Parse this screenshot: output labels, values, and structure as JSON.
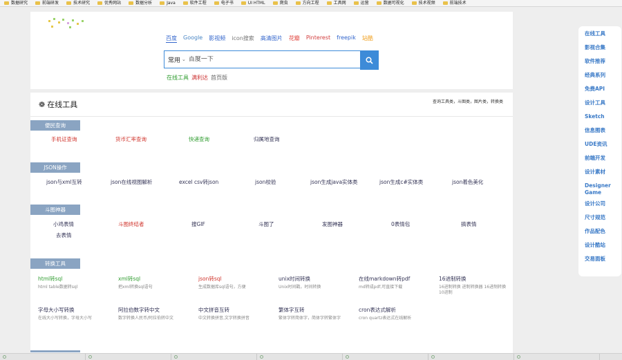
{
  "bookmarks": [
    "数据研究",
    "前端研发",
    "技术研究",
    "优秀网站",
    "数据分析",
    "Java",
    "软件工程",
    "电子书",
    "UI HTML",
    "爬虫",
    "方向工程",
    "工具网",
    "运营",
    "数据可视化",
    "技术视频",
    "前端技术"
  ],
  "search": {
    "engines": [
      {
        "label": "百度",
        "color": "#3366cc",
        "underline": true
      },
      {
        "label": "Google",
        "color": "#4a86c5"
      },
      {
        "label": "影视频",
        "color": "#3366cc"
      },
      {
        "label": "icon搜索",
        "color": "#777777"
      },
      {
        "label": "高清图片",
        "color": "#3366cc"
      },
      {
        "label": "花瓣",
        "color": "#e0433c"
      },
      {
        "label": "Pinterest",
        "color": "#d23c3c"
      },
      {
        "label": "freepik",
        "color": "#3366cc"
      },
      {
        "label": "站酷",
        "color": "#f0a020"
      }
    ],
    "scope": "常用",
    "placeholder": "百度一下",
    "sub_links": [
      {
        "label": "在线工具",
        "color": "#2f9c2f"
      },
      {
        "label": "满利达",
        "color": "#cc3333"
      },
      {
        "label": "首页版",
        "color": "#666666"
      }
    ]
  },
  "sidebar": {
    "items": [
      "在线工具",
      "影视合集",
      "软件推荐",
      "经典系列",
      "免费API",
      "设计工具",
      "Sketch",
      "信息图表",
      "UDE资讯",
      "前端开发",
      "设计素材",
      "Designer Game",
      "设计公司",
      "尺寸规范",
      "作品配色",
      "设计酷站",
      "交易面板"
    ]
  },
  "tools": {
    "title": "在线工具",
    "note": "查询工具类，斗图类，图片类，转换类",
    "categories": [
      {
        "name": "便民查询",
        "links": [
          {
            "label": "手机证查询",
            "color": "#d0342c"
          },
          {
            "label": "货币汇率查询",
            "color": "#d0342c"
          },
          {
            "label": "快递查询",
            "color": "#2f9c2f"
          },
          {
            "label": "归属地查询",
            "color": "#333355"
          }
        ]
      },
      {
        "name": "JSON操作",
        "links": [
          {
            "label": "json与xml互转",
            "color": "#333355"
          },
          {
            "label": "json在线视图解析",
            "color": "#333355"
          },
          {
            "label": "excel csv转json",
            "color": "#333355"
          },
          {
            "label": "json校验",
            "color": "#333355"
          },
          {
            "label": "json生成java实体类",
            "color": "#333355"
          },
          {
            "label": "json生成c#实体类",
            "color": "#333355"
          },
          {
            "label": "json着色美化",
            "color": "#333355"
          }
        ]
      },
      {
        "name": "斗图神器",
        "links": [
          {
            "label": "小鸡表情",
            "color": "#333355"
          },
          {
            "label": "斗图终结者",
            "color": "#d0342c"
          },
          {
            "label": "搜GIF",
            "color": "#333355"
          },
          {
            "label": "斗图了",
            "color": "#333355"
          },
          {
            "label": "发图神器",
            "color": "#333355"
          },
          {
            "label": "0表情包",
            "color": "#333355"
          },
          {
            "label": "搞表情",
            "color": "#333355"
          },
          {
            "label": "去表情",
            "color": "#333355"
          }
        ]
      },
      {
        "name": "转换工具",
        "items": [
          {
            "title": "html转sql",
            "title_color": "#2f9c2f",
            "desc": "html table数据转sql"
          },
          {
            "title": "xml转sql",
            "title_color": "#2f9c2f",
            "desc": "把xml转换sql语句"
          },
          {
            "title": "json转sql",
            "title_color": "#d0342c",
            "desc": "生成数据库sql语句，方便"
          },
          {
            "title": "unix时间转换",
            "title_color": "#333355",
            "desc": "Unix时间戳，时间转换"
          },
          {
            "title": "在线markdown转pdf",
            "title_color": "#333355",
            "desc": "md转成pdf,可直接下载"
          },
          {
            "title": "16进制转换",
            "title_color": "#333355",
            "desc": "16进制转换 进制转换器 16进制转换10进制"
          },
          {
            "title": "字母大小写转换",
            "title_color": "#333355",
            "desc": "在线大小写转换，字母大小写"
          },
          {
            "title": "阿拉伯数字转中文",
            "title_color": "#333355",
            "desc": "数字转换人民币/阿拉伯转中文"
          },
          {
            "title": "中文拼音互转",
            "title_color": "#333355",
            "desc": "中文转换拼音,文字转换拼音"
          },
          {
            "title": "繁体字互转",
            "title_color": "#333355",
            "desc": "繁体字转简体字，简体字转繁体字"
          },
          {
            "title": "cron表达式解析",
            "title_color": "#333355",
            "desc": "cron quartz表达式在线解析"
          }
        ]
      }
    ]
  },
  "bottom_tabs": [
    "",
    "",
    "",
    "",
    "",
    "",
    ""
  ],
  "colors": {
    "accent": "#3d8bd8",
    "category_bg": "#8aa4c2",
    "sidebar_link": "#3a7ac7"
  }
}
